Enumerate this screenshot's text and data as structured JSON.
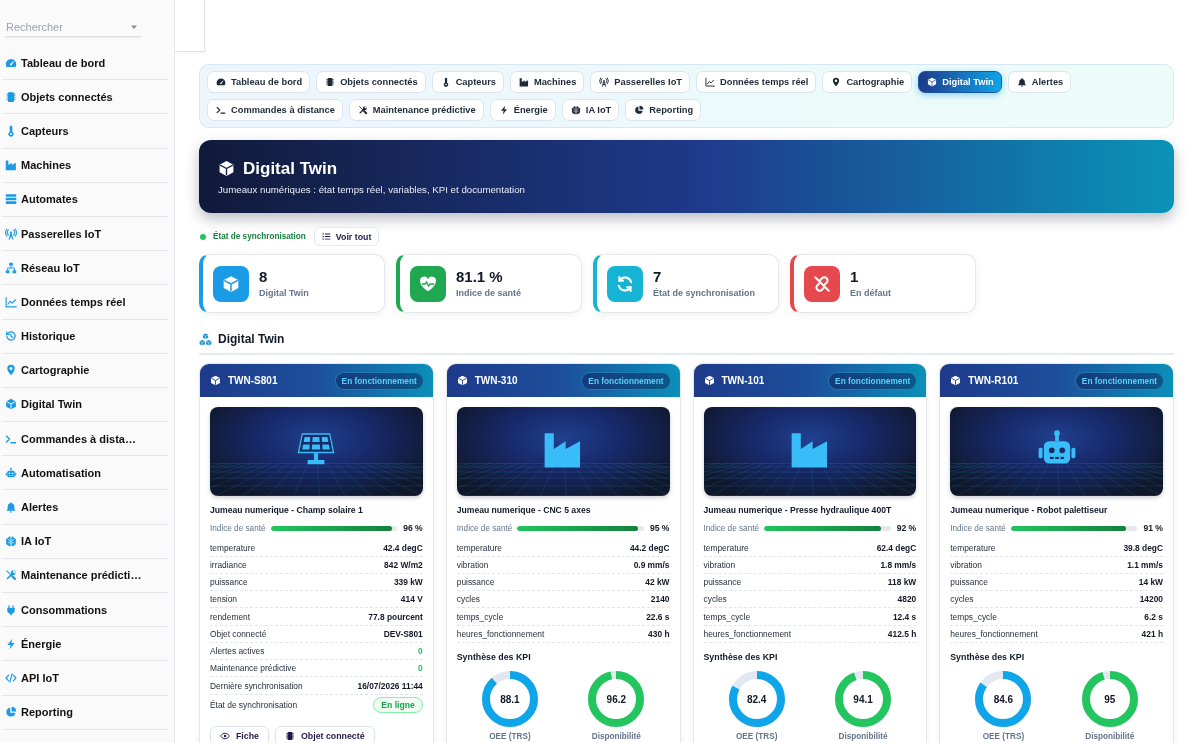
{
  "sidebar": {
    "search": {
      "placeholder": "Rechercher"
    },
    "items": [
      "Tableau de bord",
      "Objets connectés",
      "Capteurs",
      "Machines",
      "Automates",
      "Passerelles IoT",
      "Réseau IoT",
      "Données temps réel",
      "Historique",
      "Cartographie",
      "Digital Twin",
      "Commandes à dista…",
      "Automatisation",
      "Alertes",
      "IA IoT",
      "Maintenance prédicti…",
      "Consommations",
      "Énergie",
      "API IoT",
      "Reporting"
    ]
  },
  "tab_rows": [
    {
      "tabs": [
        {
          "label": "Tableau de bord",
          "selected": false
        },
        {
          "label": "Objets connectés",
          "selected": false
        },
        {
          "label": "Capteurs",
          "selected": false
        },
        {
          "label": "Machines",
          "selected": false
        },
        {
          "label": "Passerelles IoT",
          "selected": false
        },
        {
          "label": "Données temps réel",
          "selected": false
        },
        {
          "label": "Cartographie",
          "selected": false
        },
        {
          "label": "Digital Twin",
          "selected": true
        },
        {
          "label": "Alertes",
          "selected": false
        }
      ]
    },
    {
      "tabs": [
        {
          "label": "Commandes à distance",
          "selected": false
        },
        {
          "label": "Maintenance prédictive",
          "selected": false
        },
        {
          "label": "Énergie",
          "selected": false
        },
        {
          "label": "IA IoT",
          "selected": false
        },
        {
          "label": "Reporting",
          "selected": false
        }
      ]
    }
  ],
  "banner": {
    "title": "Digital Twin",
    "subtitle": "Jumeaux numériques : état temps réel, variables, KPI et documentation"
  },
  "sync": {
    "label": "État de synchronisation",
    "button": "Voir tout"
  },
  "stats": [
    {
      "value": "8",
      "label": "Digital Twin",
      "color": "#1a9be6"
    },
    {
      "value": "81.1 %",
      "label": "Indice de santé",
      "color": "#1fa84f"
    },
    {
      "value": "7",
      "label": "État de synchronisation",
      "color": "#16b4d4"
    },
    {
      "value": "1",
      "label": "En défaut",
      "color": "#e5484d"
    }
  ],
  "section": {
    "title": "Digital Twin"
  },
  "cards": [
    {
      "kind": "solar",
      "id": "TWN-S801",
      "status": "En fonctionnement",
      "title": "Jumeau numerique - Champ solaire 1",
      "health": {
        "label": "Indice de santé",
        "level": 0.96,
        "reading": "96 %"
      },
      "rows": [
        {
          "kind": "text",
          "label": "temperature",
          "value": "42.4 degC"
        },
        {
          "kind": "text",
          "label": "irradiance",
          "value": "842 W/m2"
        },
        {
          "kind": "text",
          "label": "puissance",
          "value": "339 kW"
        },
        {
          "kind": "text",
          "label": "tension",
          "value": "414 V"
        },
        {
          "kind": "text",
          "label": "rendement",
          "value": "77.8 pourcent"
        },
        {
          "kind": "text",
          "label": "Objet connecté",
          "value": "DEV-S801"
        },
        {
          "kind": "count",
          "label": "Alertes actives",
          "value": "0"
        },
        {
          "kind": "count",
          "label": "Maintenance prédictive",
          "value": "0"
        },
        {
          "kind": "text",
          "label": "Dernière synchronisation",
          "value": "16/07/2026 11:44"
        },
        {
          "kind": "badge",
          "label": "État de synchronisation",
          "value": "En ligne"
        }
      ],
      "buttons": [
        "Fiche",
        "Objet connecté"
      ]
    },
    {
      "kind": "factory",
      "id": "TWN-310",
      "status": "En fonctionnement",
      "title": "Jumeau numerique - CNC 5 axes",
      "health": {
        "label": "Indice de santé",
        "level": 0.95,
        "reading": "95 %"
      },
      "rows": [
        {
          "kind": "text",
          "label": "temperature",
          "value": "44.2 degC"
        },
        {
          "kind": "text",
          "label": "vibration",
          "value": "0.9 mm/s"
        },
        {
          "kind": "text",
          "label": "puissance",
          "value": "42 kW"
        },
        {
          "kind": "text",
          "label": "cycles",
          "value": "2140"
        },
        {
          "kind": "text",
          "label": "temps_cycle",
          "value": "22.6 s"
        },
        {
          "kind": "text",
          "label": "heures_fonctionnement",
          "value": "430 h"
        }
      ],
      "kpi_title": "Synthèse des KPI",
      "kpis": [
        {
          "label": "OEE (TRS)",
          "value": "88.1",
          "level": 0.881,
          "color": "#0ea5e9"
        },
        {
          "label": "Disponibilité",
          "value": "96.2",
          "level": 0.962,
          "color": "#22c55e"
        }
      ]
    },
    {
      "kind": "factory",
      "id": "TWN-101",
      "status": "En fonctionnement",
      "title": "Jumeau numerique - Presse hydraulique 400T",
      "health": {
        "label": "Indice de santé",
        "level": 0.92,
        "reading": "92 %"
      },
      "rows": [
        {
          "kind": "text",
          "label": "temperature",
          "value": "62.4 degC"
        },
        {
          "kind": "text",
          "label": "vibration",
          "value": "1.8 mm/s"
        },
        {
          "kind": "text",
          "label": "puissance",
          "value": "118 kW"
        },
        {
          "kind": "text",
          "label": "cycles",
          "value": "4820"
        },
        {
          "kind": "text",
          "label": "temps_cycle",
          "value": "12.4 s"
        },
        {
          "kind": "text",
          "label": "heures_fonctionnement",
          "value": "412.5 h"
        }
      ],
      "kpi_title": "Synthèse des KPI",
      "kpis": [
        {
          "label": "OEE (TRS)",
          "value": "82.4",
          "level": 0.824,
          "color": "#0ea5e9"
        },
        {
          "label": "Disponibilité",
          "value": "94.1",
          "level": 0.941,
          "color": "#22c55e"
        }
      ]
    },
    {
      "kind": "robot",
      "id": "TWN-R101",
      "status": "En fonctionnement",
      "title": "Jumeau numerique - Robot palettiseur",
      "health": {
        "label": "Indice de santé",
        "level": 0.91,
        "reading": "91 %"
      },
      "rows": [
        {
          "kind": "text",
          "label": "temperature",
          "value": "39.8 degC"
        },
        {
          "kind": "text",
          "label": "vibration",
          "value": "1.1 mm/s"
        },
        {
          "kind": "text",
          "label": "puissance",
          "value": "14 kW"
        },
        {
          "kind": "text",
          "label": "cycles",
          "value": "14200"
        },
        {
          "kind": "text",
          "label": "temps_cycle",
          "value": "6.2 s"
        },
        {
          "kind": "text",
          "label": "heures_fonctionnement",
          "value": "421 h"
        }
      ],
      "kpi_title": "Synthèse des KPI",
      "kpis": [
        {
          "label": "OEE (TRS)",
          "value": "84.6",
          "level": 0.846,
          "color": "#0ea5e9"
        },
        {
          "label": "Disponibilité",
          "value": "95",
          "level": 0.95,
          "color": "#22c55e"
        }
      ]
    }
  ]
}
